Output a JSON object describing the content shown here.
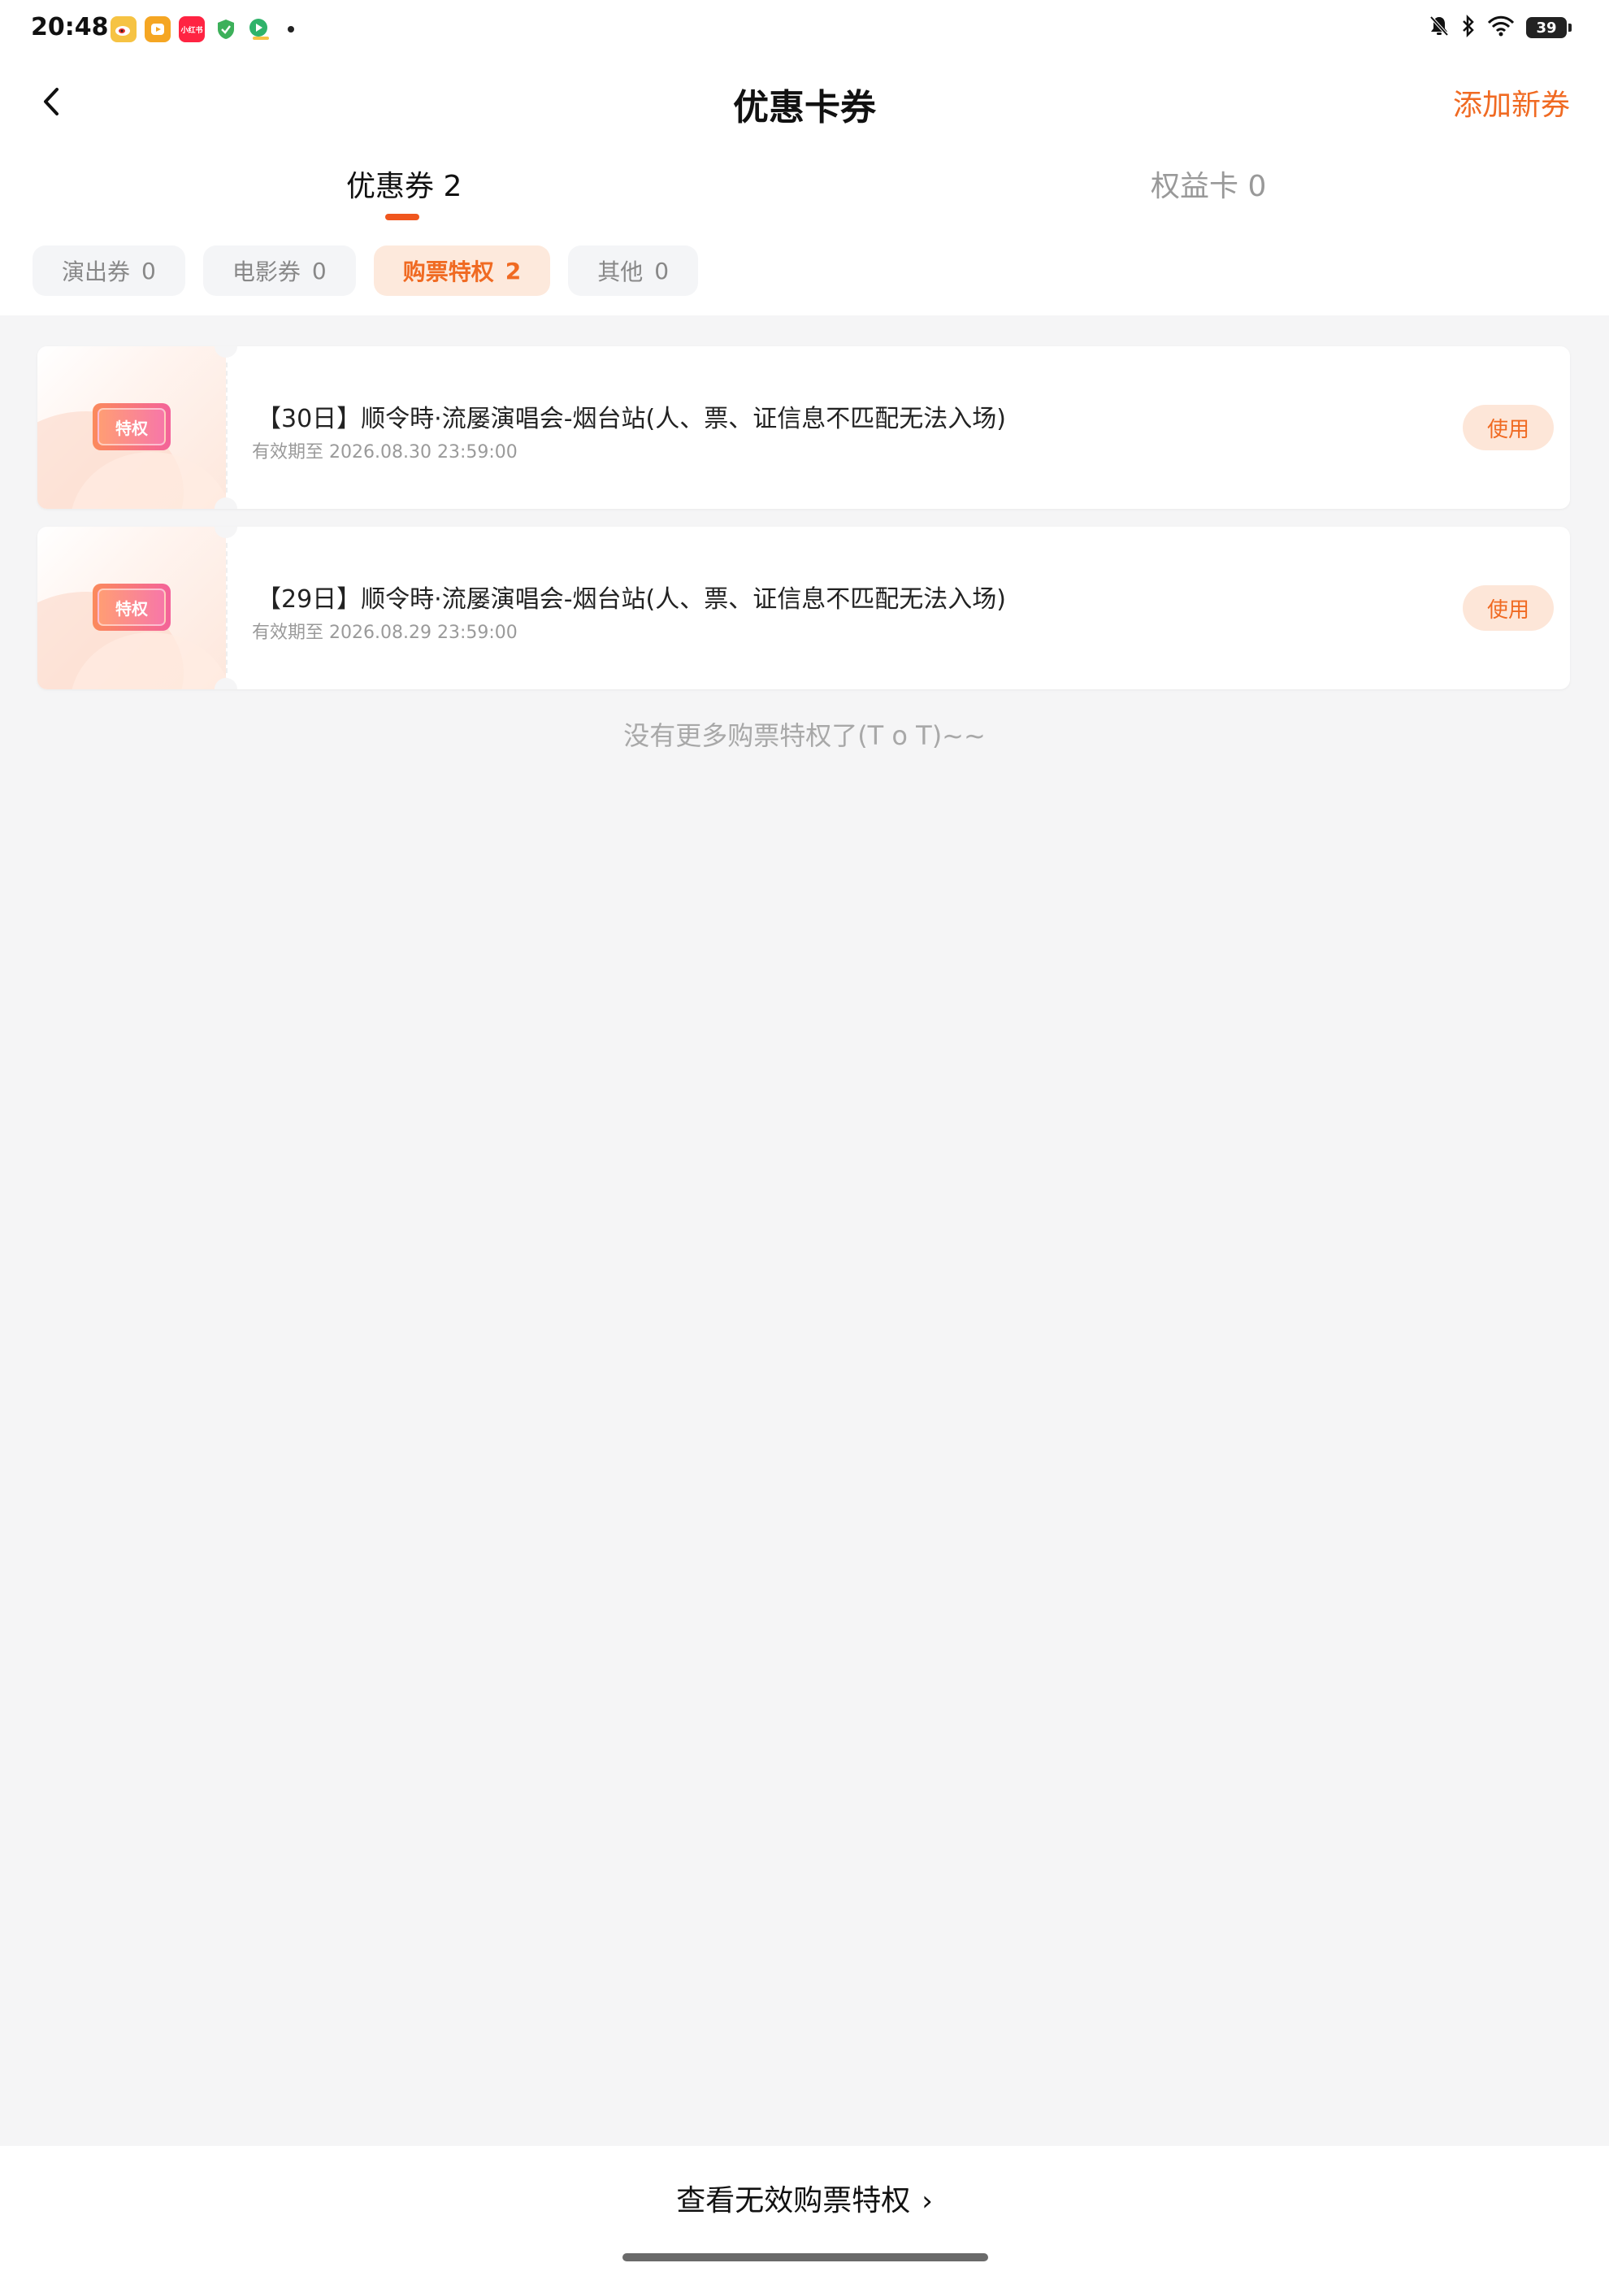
{
  "status_bar": {
    "time": "20:48",
    "battery": "39",
    "app_icons": [
      {
        "name": "weibo-icon",
        "color": "#f6c343"
      },
      {
        "name": "video-app-icon",
        "color": "#f5a623"
      },
      {
        "name": "xiaohongshu-icon",
        "color": "#ff2442",
        "label": "小红书"
      },
      {
        "name": "security-shield-icon",
        "color": "#3db05a"
      },
      {
        "name": "play-app-icon",
        "color": "#2fb36a"
      }
    ]
  },
  "nav": {
    "title": "优惠卡券",
    "action": "添加新券"
  },
  "tabs": {
    "coupon": "优惠券 2",
    "rights": "权益卡 0"
  },
  "chips": [
    {
      "label": "演出券",
      "count": "0"
    },
    {
      "label": "电影券",
      "count": "0"
    },
    {
      "label": "购票特权",
      "count": "2"
    },
    {
      "label": "其他",
      "count": "0"
    }
  ],
  "coupons": [
    {
      "badge": "特权",
      "title": "【30日】顺令時·流屡演唱会-烟台站(人、票、证信息不匹配无法入场)",
      "expire": "有效期至 2026.08.30 23:59:00",
      "button": "使用"
    },
    {
      "badge": "特权",
      "title": "【29日】顺令時·流屡演唱会-烟台站(人、票、证信息不匹配无法入场)",
      "expire": "有效期至 2026.08.29 23:59:00",
      "button": "使用"
    }
  ],
  "no_more": "没有更多购票特权了(T o T)~~",
  "bottom": {
    "link": "查看无效购票特权",
    "chevron": "›"
  },
  "colors": {
    "accent": "#f06a22",
    "indicator": "#f0561e",
    "background": "#f5f5f6"
  }
}
